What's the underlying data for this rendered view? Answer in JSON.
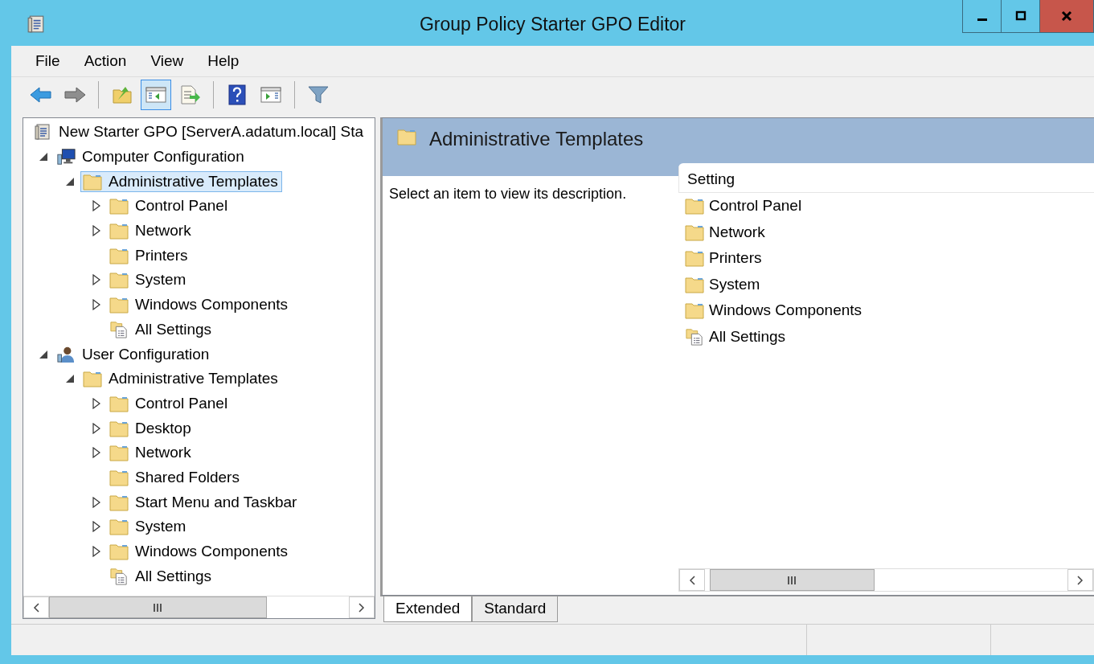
{
  "window": {
    "title": "Group Policy Starter GPO Editor"
  },
  "menu": [
    "File",
    "Action",
    "View",
    "Help"
  ],
  "toolbar": [
    {
      "kind": "back",
      "selected": false
    },
    {
      "kind": "forward",
      "selected": false
    },
    {
      "kind": "sep"
    },
    {
      "kind": "up",
      "selected": false
    },
    {
      "kind": "tree",
      "selected": true
    },
    {
      "kind": "export",
      "selected": false
    },
    {
      "kind": "sep"
    },
    {
      "kind": "help",
      "selected": false
    },
    {
      "kind": "action",
      "selected": false
    },
    {
      "kind": "sep"
    },
    {
      "kind": "filter",
      "selected": false
    }
  ],
  "tree": [
    {
      "label": "New Starter GPO [ServerA.adatum.local] Sta",
      "kind": "gpo",
      "selected": false,
      "children": [
        {
          "label": "Computer Configuration",
          "kind": "computer",
          "expanded": true,
          "selected": false,
          "children": [
            {
              "label": "Administrative Templates",
              "kind": "folder",
              "expanded": true,
              "selected": true,
              "children": [
                {
                  "label": "Control Panel",
                  "kind": "folder",
                  "expanded": false,
                  "selected": false
                },
                {
                  "label": "Network",
                  "kind": "folder",
                  "expanded": false,
                  "selected": false
                },
                {
                  "label": "Printers",
                  "kind": "folder",
                  "selected": false
                },
                {
                  "label": "System",
                  "kind": "folder",
                  "expanded": false,
                  "selected": false
                },
                {
                  "label": "Windows Components",
                  "kind": "folder",
                  "expanded": false,
                  "selected": false
                },
                {
                  "label": "All Settings",
                  "kind": "settings",
                  "selected": false
                }
              ]
            }
          ]
        },
        {
          "label": "User Configuration",
          "kind": "user",
          "expanded": true,
          "selected": false,
          "children": [
            {
              "label": "Administrative Templates",
              "kind": "folder",
              "expanded": true,
              "selected": false,
              "children": [
                {
                  "label": "Control Panel",
                  "kind": "folder",
                  "expanded": false,
                  "selected": false
                },
                {
                  "label": "Desktop",
                  "kind": "folder",
                  "expanded": false,
                  "selected": false
                },
                {
                  "label": "Network",
                  "kind": "folder",
                  "expanded": false,
                  "selected": false
                },
                {
                  "label": "Shared Folders",
                  "kind": "folder",
                  "selected": false
                },
                {
                  "label": "Start Menu and Taskbar",
                  "kind": "folder",
                  "expanded": false,
                  "selected": false
                },
                {
                  "label": "System",
                  "kind": "folder",
                  "expanded": false,
                  "selected": false
                },
                {
                  "label": "Windows Components",
                  "kind": "folder",
                  "expanded": false,
                  "selected": false
                },
                {
                  "label": "All Settings",
                  "kind": "settings",
                  "selected": false
                }
              ]
            }
          ]
        }
      ]
    }
  ],
  "details": {
    "title": "Administrative Templates",
    "description": "Select an item to view its description.",
    "column": "Setting",
    "items": [
      {
        "label": "Control Panel",
        "kind": "folder"
      },
      {
        "label": "Network",
        "kind": "folder"
      },
      {
        "label": "Printers",
        "kind": "folder"
      },
      {
        "label": "System",
        "kind": "folder"
      },
      {
        "label": "Windows Components",
        "kind": "folder"
      },
      {
        "label": "All Settings",
        "kind": "settings"
      }
    ]
  },
  "tabs": [
    {
      "label": "Extended",
      "selected": true
    },
    {
      "label": "Standard",
      "selected": false
    }
  ]
}
